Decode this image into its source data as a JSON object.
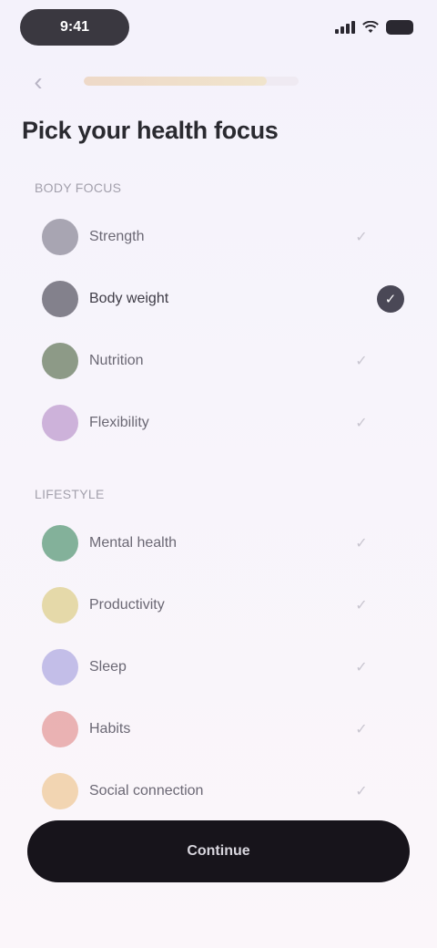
{
  "status": {
    "time": "9:41"
  },
  "progress": {
    "fraction": 0.85
  },
  "title": "Pick your health focus",
  "sections": [
    {
      "label": "BODY FOCUS",
      "items": [
        {
          "label": "Strength",
          "icon": "dumbbell-icon",
          "color": "#9a97a4",
          "selected": false
        },
        {
          "label": "Body weight",
          "icon": "scale-icon",
          "color": "#6f6c78",
          "selected": true
        },
        {
          "label": "Nutrition",
          "icon": "leaf-icon",
          "color": "#7a8a72",
          "selected": false
        },
        {
          "label": "Flexibility",
          "icon": "stretch-icon",
          "color": "#c6a6d4",
          "selected": false
        }
      ]
    },
    {
      "label": "LIFESTYLE",
      "items": [
        {
          "label": "Mental health",
          "icon": "brain-icon",
          "color": "#6fa488",
          "selected": false
        },
        {
          "label": "Productivity",
          "icon": "bolt-icon",
          "color": "#e2d49a",
          "selected": false
        },
        {
          "label": "Sleep",
          "icon": "moon-icon",
          "color": "#bab4e4",
          "selected": false
        },
        {
          "label": "Habits",
          "icon": "heart-icon",
          "color": "#e6a6a6",
          "selected": false
        },
        {
          "label": "Social connection",
          "icon": "people-icon",
          "color": "#f0cfa4",
          "selected": false
        }
      ]
    }
  ],
  "continue_label": "Continue",
  "icons": {
    "back": "chevron-left-icon",
    "check": "check-icon"
  }
}
